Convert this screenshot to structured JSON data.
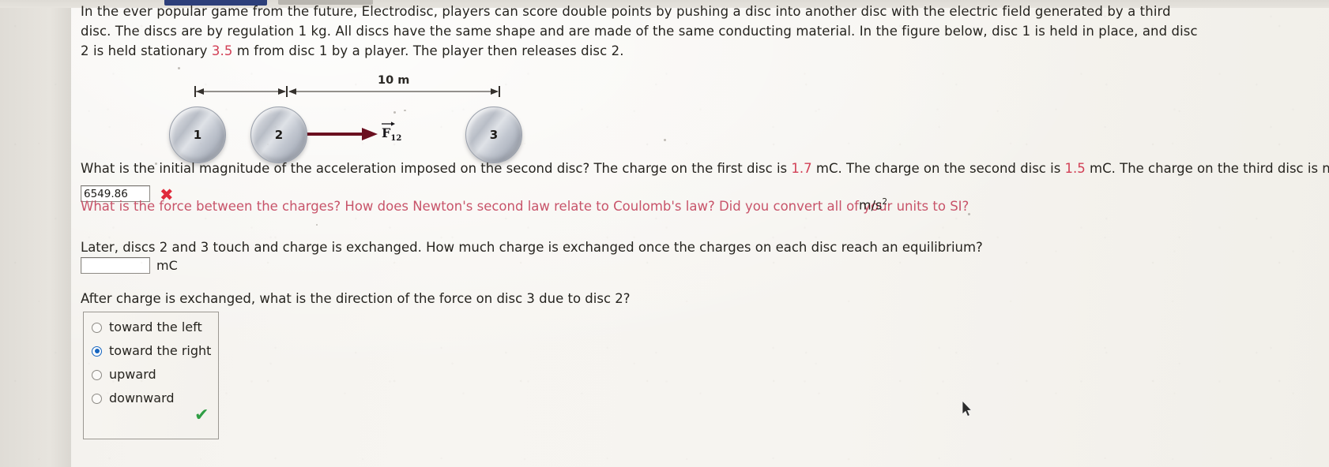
{
  "window": {
    "tabs": [
      "active-tab",
      "inactive-tab"
    ]
  },
  "problem": {
    "intro_part1": "In the ever popular game from the future, Electrodisc, players can score double points by pushing a disc into another disc with the electric field generated by a third disc. The discs are by regulation 1 kg. All discs have the same shape and are made of the same conducting material. In the figure below, disc 1 is held in place, and disc 2 is held stationary ",
    "intro_distance": "3.5",
    "intro_part2": " m from disc 1 by a player. The player then releases disc 2."
  },
  "figure": {
    "dimension_label": "10 m",
    "disc1_label": "1",
    "disc2_label": "2",
    "disc3_label": "3",
    "force_label": "F",
    "force_subscript": "12"
  },
  "question1": {
    "text_part1": "What is the initial magnitude of the acceleration imposed on the second disc? The charge on the first disc is ",
    "charge1": "1.7",
    "text_part2": " mC. The charge on the second disc is ",
    "charge2": "1.5",
    "text_part3": " mC. The charge on the third disc is neutral.",
    "answer_value": "6549.86",
    "answer_placeholder": "",
    "status_icon": "x-mark-incorrect",
    "hint": "What is the force between the charges? How does Newton's second law relate to Coulomb's law? Did you convert all of your units to SI?",
    "unit": "m/s",
    "unit_exponent": "2"
  },
  "question2": {
    "text": "Later, discs 2 and 3 touch and charge is exchanged. How much charge is exchanged once the charges on each disc reach an equilibrium?",
    "answer_value": "",
    "answer_placeholder": "",
    "unit": "mC"
  },
  "question3": {
    "text": "After charge is exchanged, what is the direction of the force on disc 3 due to disc 2?",
    "options": [
      {
        "label": "toward the left",
        "selected": false
      },
      {
        "label": "toward the right",
        "selected": true
      },
      {
        "label": "upward",
        "selected": false
      },
      {
        "label": "downward",
        "selected": false
      }
    ],
    "status_icon": "check-mark-correct",
    "status_glyph": "✔"
  },
  "colors": {
    "error_red": "#e02b3c",
    "hint_red": "#c8546a",
    "value_red": "#d23f55",
    "success_green": "#2f9e44",
    "radio_blue": "#1565c0",
    "force_arrow": "#6b1020"
  }
}
